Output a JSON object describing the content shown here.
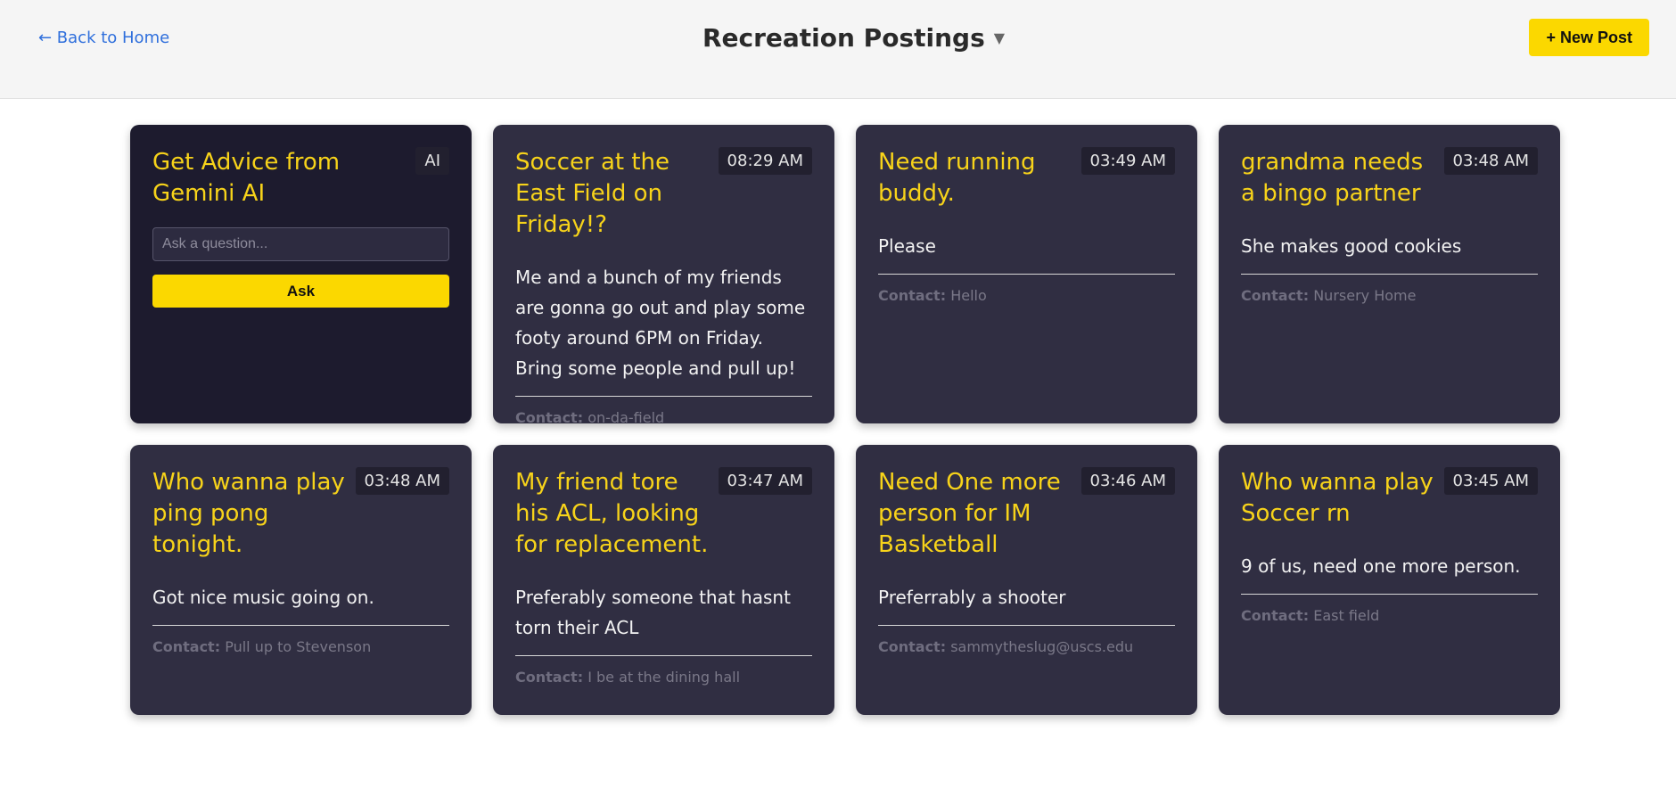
{
  "header": {
    "back_label": "← Back to Home",
    "title": "Recreation Postings",
    "caret": "▼",
    "new_post_label": "+ New Post"
  },
  "ai_card": {
    "title": "Get Advice from Gemini AI",
    "badge": "AI",
    "input_placeholder": "Ask a question...",
    "ask_label": "Ask"
  },
  "contact_label": "Contact:",
  "posts": [
    {
      "title": "Soccer at the East Field on Friday!?",
      "time": "08:29 AM",
      "body": "Me and a bunch of my friends are gonna go out and play some footy around 6PM on Friday. Bring some people and pull up!",
      "contact": "on-da-field"
    },
    {
      "title": "Need running buddy.",
      "time": "03:49 AM",
      "body": "Please",
      "contact": "Hello"
    },
    {
      "title": "grandma needs a bingo partner",
      "time": "03:48 AM",
      "body": "She makes good cookies",
      "contact": "Nursery Home"
    },
    {
      "title": "Who wanna play ping pong tonight.",
      "time": "03:48 AM",
      "body": "Got nice music going on.",
      "contact": "Pull up to Stevenson"
    },
    {
      "title": "My friend tore his ACL, looking for replacement.",
      "time": "03:47 AM",
      "body": "Preferably someone that hasnt torn their ACL",
      "contact": "I be at the dining hall"
    },
    {
      "title": "Need One more person for IM Basketball",
      "time": "03:46 AM",
      "body": "Preferrably a shooter",
      "contact": "sammytheslug@uscs.edu"
    },
    {
      "title": "Who wanna play Soccer rn",
      "time": "03:45 AM",
      "body": "9 of us, need one more person.",
      "contact": "East field"
    }
  ],
  "colors": {
    "accent": "#fbd800",
    "card_bg": "#302e42",
    "ai_card_bg": "#1d1b2e",
    "link": "#2f6fdc"
  }
}
